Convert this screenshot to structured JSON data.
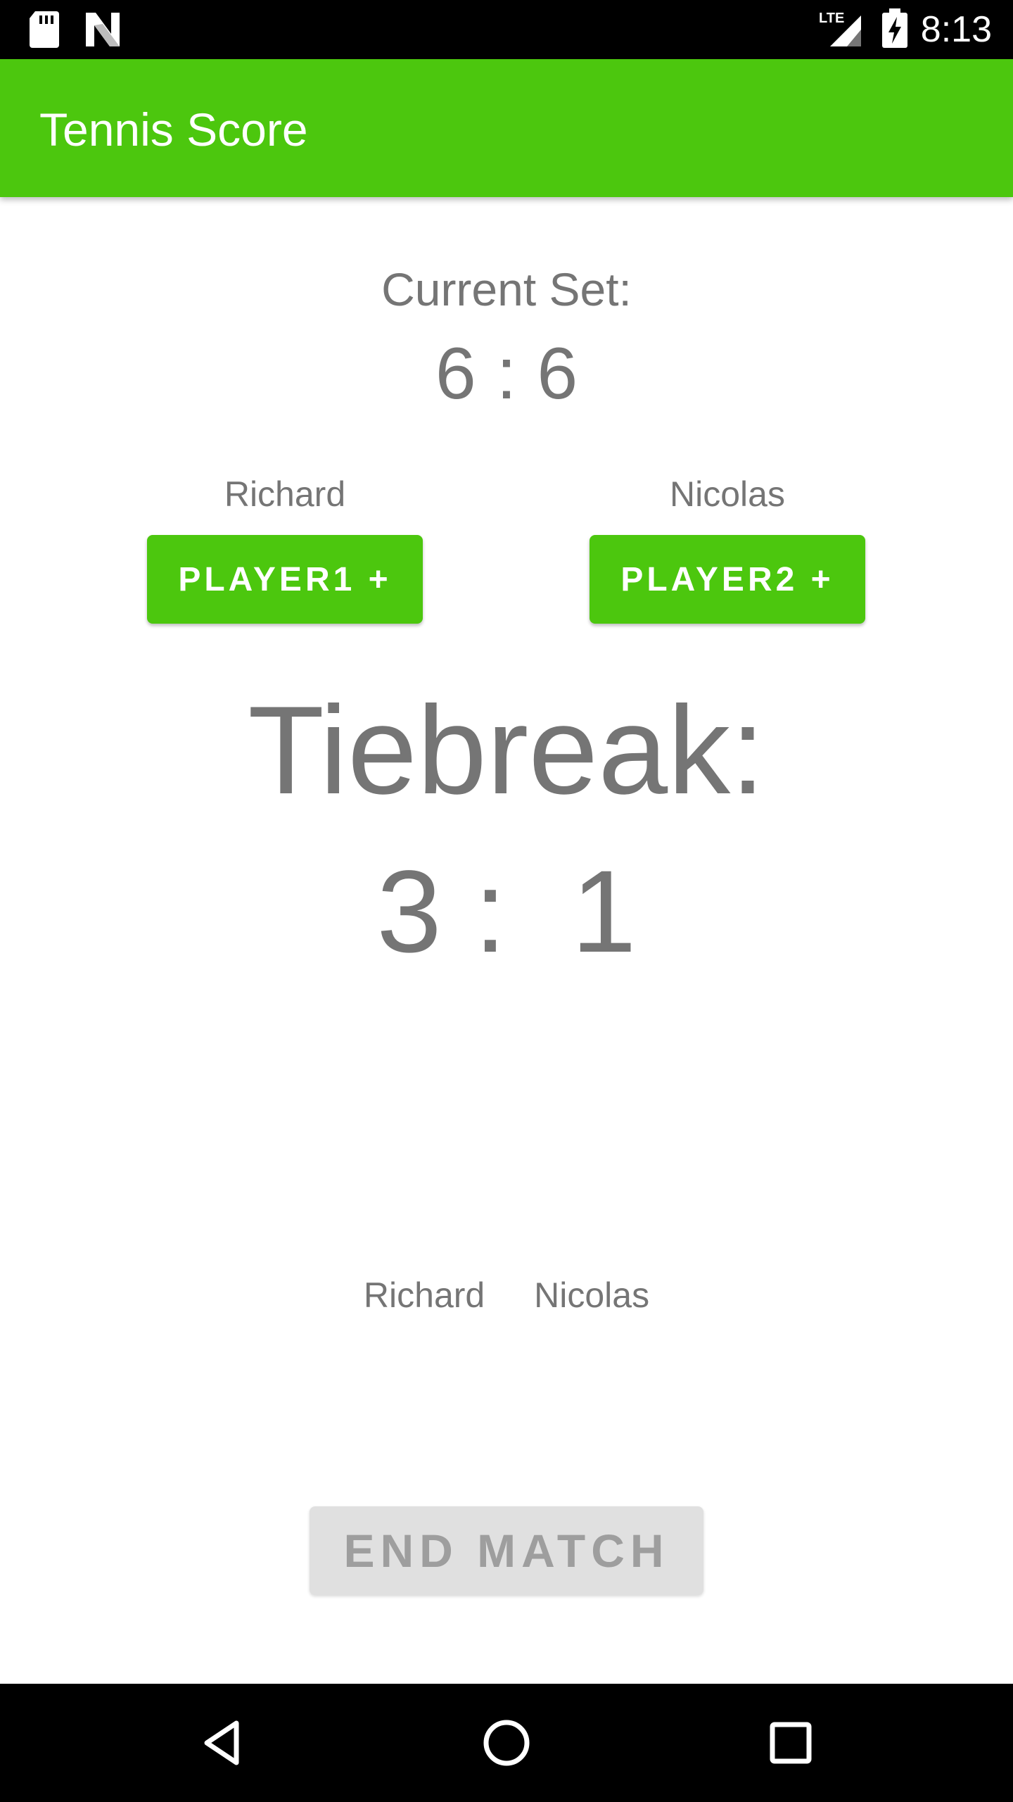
{
  "status_bar": {
    "time": "8:13",
    "network_label": "LTE",
    "icons": [
      "sd-card-icon",
      "n-logo-icon",
      "signal-icon",
      "battery-charging-icon"
    ]
  },
  "app_bar": {
    "title": "Tennis Score"
  },
  "current_set": {
    "label": "Current Set:",
    "score": "6 : 6"
  },
  "players": [
    {
      "name": "Richard",
      "button_label": "PLAYER1 +"
    },
    {
      "name": "Nicolas",
      "button_label": "PLAYER2 +"
    }
  ],
  "tiebreak": {
    "label": "Tiebreak:",
    "score": "3 :  1"
  },
  "sets_header": {
    "player1": "Richard",
    "player2": "Nicolas"
  },
  "end_match": {
    "label": "END MATCH",
    "enabled": false
  },
  "nav_bar": {
    "icons": [
      "back-icon",
      "home-icon",
      "recents-icon"
    ]
  },
  "colors": {
    "primary": "#4cc70e",
    "text_secondary": "#757575",
    "disabled_button": "#e0e0e0",
    "disabled_text": "#9e9e9e"
  }
}
